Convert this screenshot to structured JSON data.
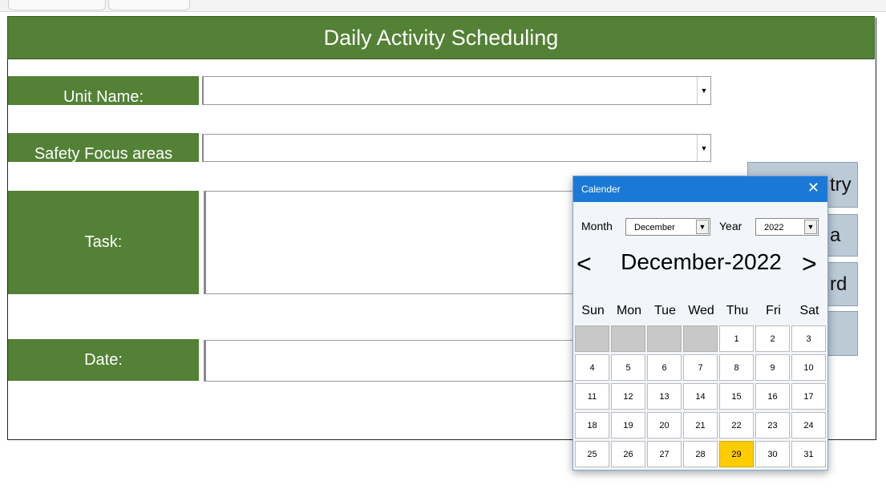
{
  "form": {
    "title": "Daily Activity Scheduling",
    "unit_name_label": "Unit Name:",
    "unit_name_value": "",
    "safety_label": "Safety Focus areas",
    "safety_value": "",
    "task_label": "Task:",
    "task_value": "",
    "date_label": "Date:",
    "date_value": ""
  },
  "side_buttons": {
    "entry_partial": "try",
    "second_partial": "a",
    "record_partial": "rd",
    "fourth_partial": ""
  },
  "calendar": {
    "window_title": "Calender",
    "close_glyph": "✕",
    "month_label": "Month",
    "month_value": "December",
    "year_label": "Year",
    "year_value": "2022",
    "prev_glyph": "<",
    "next_glyph": ">",
    "heading": "December-2022",
    "weekdays": [
      "Sun",
      "Mon",
      "Tue",
      "Wed",
      "Thu",
      "Fri",
      "Sat"
    ],
    "days": [
      [
        "",
        "",
        "",
        "",
        "1",
        "2",
        "3"
      ],
      [
        "4",
        "5",
        "6",
        "7",
        "8",
        "9",
        "10"
      ],
      [
        "11",
        "12",
        "13",
        "14",
        "15",
        "16",
        "17"
      ],
      [
        "18",
        "19",
        "20",
        "21",
        "22",
        "23",
        "24"
      ],
      [
        "25",
        "26",
        "27",
        "28",
        "29",
        "30",
        "31"
      ],
      [
        "",
        "",
        "",
        "",
        "",
        "",
        ""
      ]
    ],
    "selected_day": "29",
    "colors": {
      "selected": "#ffcc00",
      "titlebar": "#1a79d6"
    }
  },
  "colors": {
    "header_green": "#538135",
    "button_blue": "#bcc9d6"
  },
  "icons": {
    "dropdown": "dropdown-arrow-icon"
  }
}
